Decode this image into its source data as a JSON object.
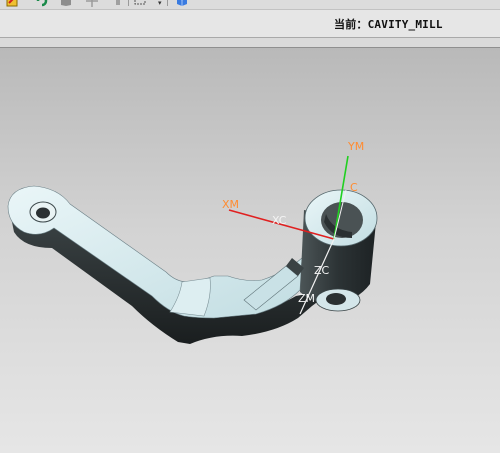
{
  "status": {
    "text": "当前：CAVITY_MILL"
  },
  "toolbar": {
    "icons": [
      "tool-icon",
      "refresh-icon",
      "box-icon",
      "move-icon",
      "pin-icon",
      "view-select-icon",
      "cube-icon"
    ]
  },
  "axes": {
    "ym_label": "YM",
    "xm_label": "XM",
    "xc_label": "XC",
    "yc_label": "C",
    "zc_label": "ZC",
    "zm_label": "ZM",
    "colors": {
      "xm": "#e02020",
      "ym": "#20d020",
      "label": "#ff8c32"
    }
  }
}
